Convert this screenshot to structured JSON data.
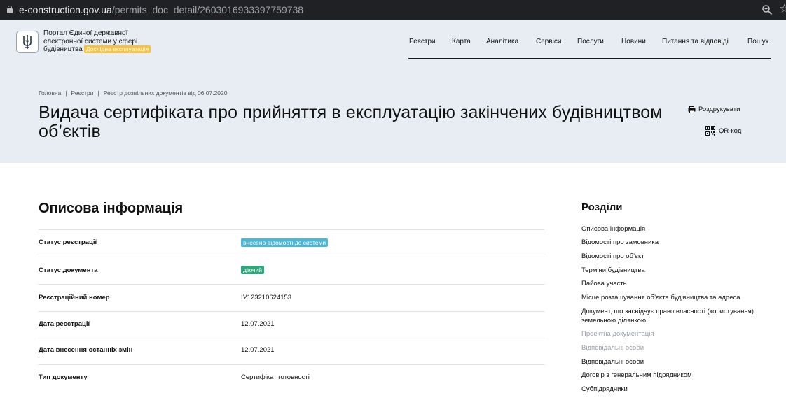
{
  "browser": {
    "url_host": "e-construction.gov.ua",
    "url_path": "/permits_doc_detail/2603016933397759738"
  },
  "header": {
    "portal_name": "Портал Єдиної державної електронної системи у сфері будівництва",
    "beta_label": "Дослідна експлуатація",
    "nav": [
      "Реєстри",
      "Карта",
      "Аналітика",
      "Сервіси",
      "Послуги",
      "Новини",
      "Питання та відповіді",
      "Пошук"
    ]
  },
  "breadcrumbs": [
    "Головна",
    "Реєстри",
    "Реєстр дозвільних документів від 06.07.2020"
  ],
  "page_title": "Видача сертифіката про прийняття в експлуатацію закінчених будівництвом об’єктів",
  "actions": {
    "print": "Роздрукувати",
    "qr": "QR-код"
  },
  "main": {
    "section_title": "Описова інформація",
    "rows": [
      {
        "label": "Статус реєстрації",
        "value": "внесено відомості до системи",
        "badge_color": "#4ab7d8"
      },
      {
        "label": "Статус документа",
        "value": "діючий",
        "badge_color": "#2fa77b"
      },
      {
        "label": "Реєстраційний номер",
        "value": "ІУ123210624153"
      },
      {
        "label": "Дата реєстрації",
        "value": "12.07.2021"
      },
      {
        "label": "Дата внесення останніх змін",
        "value": "12.07.2021"
      },
      {
        "label": "Тип документу",
        "value": "Сертифікат готовності"
      }
    ]
  },
  "sidebar": {
    "title": "Розділи",
    "items": [
      {
        "label": "Описова інформація",
        "muted": false
      },
      {
        "label": "Відомості про замовника",
        "muted": false
      },
      {
        "label": "Відомості про об’єкт",
        "muted": false
      },
      {
        "label": "Терміни будівництва",
        "muted": false
      },
      {
        "label": "Пайова участь",
        "muted": false
      },
      {
        "label": "Місце розташування об’єкта будівництва та адреса",
        "muted": false
      },
      {
        "label": "Документ, що засвідчує право власності (користування) земельною ділянкою",
        "muted": false
      },
      {
        "label": "Проектна документація",
        "muted": true
      },
      {
        "label": "Відповідальні особи",
        "muted": true
      },
      {
        "label": "Відповідальні особи",
        "muted": false
      },
      {
        "label": "Договір з генеральним підрядником",
        "muted": false
      },
      {
        "label": "Субпідрядники",
        "muted": false
      }
    ]
  }
}
